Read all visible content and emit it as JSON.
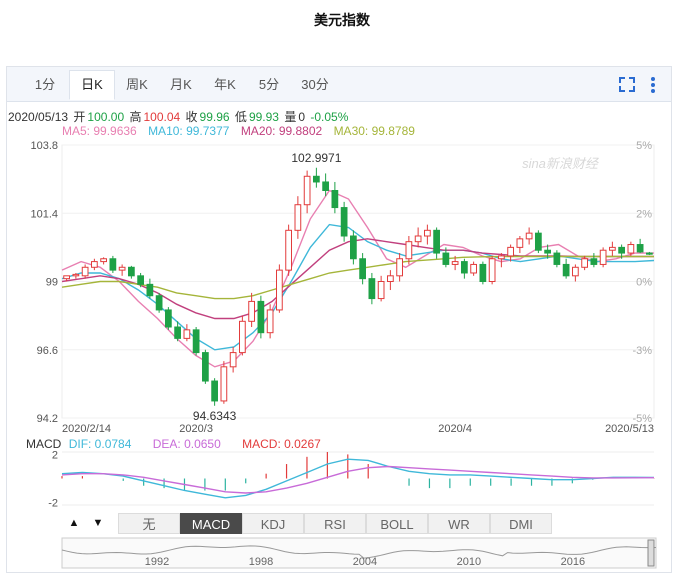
{
  "page_title": "美元指数",
  "tabs": [
    "1分",
    "日K",
    "周K",
    "月K",
    "年K",
    "5分",
    "30分"
  ],
  "active_tab": "日K",
  "toolbar": {
    "fullscreen_icon": "fullscreen-icon",
    "more_icon": "more-vertical-icon"
  },
  "quote": {
    "date": "2020/05/13",
    "open_label": "开",
    "open": "100.00",
    "high_label": "高",
    "high": "100.04",
    "close_label": "收",
    "close": "99.96",
    "low_label": "低",
    "low": "99.93",
    "volume_label": "量",
    "volume": "0",
    "change": "-0.05%"
  },
  "ma_legend": [
    {
      "label": "MA5: 99.9636",
      "color": "#e87fb1"
    },
    {
      "label": "MA10: 99.7377",
      "color": "#3fb8d9"
    },
    {
      "label": "MA20: 99.8802",
      "color": "#c1407e"
    },
    {
      "label": "MA30: 99.8789",
      "color": "#a5b53a"
    }
  ],
  "watermark": "sina新浪财经",
  "macd_legend": {
    "title": "MACD",
    "dif": "DIF: 0.0784",
    "dea": "DEA: 0.0650",
    "macd": "MACD: 0.0267"
  },
  "indicator_buttons": [
    "无",
    "MACD",
    "KDJ",
    "RSI",
    "BOLL",
    "WR",
    "DMI"
  ],
  "active_indicator": "MACD",
  "colors": {
    "up": "#e23b3b",
    "down": "#1ea146",
    "dif": "#3fb8d9",
    "dea": "#c86bd8"
  },
  "chart_data": {
    "type": "candlestick",
    "y_ticks": [
      "103.8",
      "101.4",
      "99",
      "96.6",
      "94.2"
    ],
    "ylim": [
      94.2,
      103.8
    ],
    "pct_ticks": [
      "5%",
      "2%",
      "0%",
      "-3%",
      "-5%"
    ],
    "x_tick_labels": [
      "2020/2/14",
      "2020/3",
      "2020/4",
      "2020/5/13"
    ],
    "annotations": {
      "max": "102.9971",
      "min": "94.6343"
    },
    "candles": [
      [
        99.1,
        99.2,
        99.0,
        99.2
      ],
      [
        99.2,
        99.3,
        99.1,
        99.25
      ],
      [
        99.2,
        99.6,
        99.1,
        99.5
      ],
      [
        99.5,
        99.8,
        99.4,
        99.7
      ],
      [
        99.7,
        99.85,
        99.6,
        99.8
      ],
      [
        99.8,
        99.9,
        99.3,
        99.4
      ],
      [
        99.4,
        99.6,
        99.2,
        99.5
      ],
      [
        99.5,
        99.55,
        99.1,
        99.2
      ],
      [
        99.2,
        99.3,
        98.8,
        98.9
      ],
      [
        98.9,
        99.1,
        98.4,
        98.5
      ],
      [
        98.5,
        98.6,
        97.9,
        98.0
      ],
      [
        98.0,
        98.1,
        97.3,
        97.4
      ],
      [
        97.4,
        97.6,
        96.9,
        97.0
      ],
      [
        97.0,
        97.5,
        96.9,
        97.3
      ],
      [
        97.3,
        97.4,
        96.4,
        96.5
      ],
      [
        96.5,
        96.6,
        95.4,
        95.5
      ],
      [
        95.5,
        95.6,
        94.63,
        94.8
      ],
      [
        94.8,
        96.2,
        94.7,
        96.0
      ],
      [
        96.0,
        96.7,
        95.8,
        96.5
      ],
      [
        96.5,
        97.8,
        96.4,
        97.6
      ],
      [
        97.6,
        98.6,
        97.4,
        98.3
      ],
      [
        98.3,
        98.5,
        97.0,
        97.2
      ],
      [
        97.2,
        98.2,
        97.0,
        98.0
      ],
      [
        98.0,
        99.6,
        97.9,
        99.4
      ],
      [
        99.4,
        101.0,
        99.2,
        100.8
      ],
      [
        100.8,
        102.0,
        100.5,
        101.7
      ],
      [
        101.7,
        102.9,
        101.4,
        102.7
      ],
      [
        102.7,
        103.0,
        102.3,
        102.5
      ],
      [
        102.5,
        102.8,
        102.0,
        102.2
      ],
      [
        102.2,
        102.5,
        101.4,
        101.6
      ],
      [
        101.6,
        101.8,
        100.4,
        100.6
      ],
      [
        100.6,
        100.8,
        99.6,
        99.8
      ],
      [
        99.8,
        100.0,
        98.9,
        99.1
      ],
      [
        99.1,
        99.3,
        98.2,
        98.4
      ],
      [
        98.4,
        99.2,
        98.3,
        99.0
      ],
      [
        99.0,
        99.4,
        98.7,
        99.2
      ],
      [
        99.2,
        100.0,
        99.0,
        99.8
      ],
      [
        99.8,
        100.6,
        99.6,
        100.4
      ],
      [
        100.4,
        100.9,
        100.2,
        100.6
      ],
      [
        100.6,
        101.0,
        100.3,
        100.8
      ],
      [
        100.8,
        100.9,
        99.8,
        100.0
      ],
      [
        100.0,
        100.2,
        99.5,
        99.6
      ],
      [
        99.6,
        99.9,
        99.4,
        99.7
      ],
      [
        99.7,
        99.8,
        99.1,
        99.3
      ],
      [
        99.3,
        99.7,
        99.2,
        99.6
      ],
      [
        99.6,
        99.7,
        98.9,
        99.0
      ],
      [
        99.0,
        99.9,
        98.9,
        99.8
      ],
      [
        99.8,
        100.0,
        99.5,
        99.9
      ],
      [
        99.9,
        100.3,
        99.7,
        100.2
      ],
      [
        100.2,
        100.6,
        100.0,
        100.5
      ],
      [
        100.5,
        100.9,
        100.3,
        100.7
      ],
      [
        100.7,
        100.8,
        100.0,
        100.1
      ],
      [
        100.1,
        100.3,
        99.8,
        100.0
      ],
      [
        100.0,
        100.1,
        99.5,
        99.6
      ],
      [
        99.6,
        99.8,
        99.1,
        99.2
      ],
      [
        99.2,
        99.6,
        99.0,
        99.5
      ],
      [
        99.5,
        99.9,
        99.4,
        99.8
      ],
      [
        99.8,
        100.0,
        99.5,
        99.6
      ],
      [
        99.6,
        100.2,
        99.5,
        100.1
      ],
      [
        100.1,
        100.4,
        99.9,
        100.2
      ],
      [
        100.2,
        100.3,
        99.8,
        100.0
      ],
      [
        100.0,
        100.4,
        99.9,
        100.3
      ],
      [
        100.3,
        100.5,
        100.0,
        100.04
      ],
      [
        100.0,
        100.04,
        99.93,
        99.96
      ]
    ],
    "ma": {
      "MA5": [
        99.4,
        99.7,
        99.5,
        99.0,
        98.3,
        97.7,
        97.0,
        96.4,
        96.0,
        96.2,
        96.9,
        98.0,
        99.5,
        101.2,
        102.2,
        101.9,
        100.9,
        99.8,
        99.5,
        99.9,
        100.3,
        100.2,
        99.9,
        99.7,
        99.8,
        100.2,
        100.3,
        99.9,
        99.7,
        99.8,
        100.0,
        100.0
      ],
      "MA10": [
        99.1,
        99.3,
        99.3,
        99.1,
        98.7,
        98.2,
        97.6,
        97.0,
        96.6,
        96.7,
        97.2,
        97.9,
        99.0,
        100.2,
        101.0,
        100.9,
        100.4,
        100.1,
        99.9,
        100.0,
        100.1,
        100.1,
        100.0,
        99.8,
        99.7,
        99.8,
        99.9,
        99.8,
        99.7,
        99.7,
        99.7,
        99.74
      ],
      "MA20": [
        99.0,
        99.1,
        99.2,
        99.1,
        98.9,
        98.6,
        98.2,
        97.9,
        97.7,
        97.7,
        97.9,
        98.3,
        98.9,
        99.5,
        100.1,
        100.4,
        100.5,
        100.4,
        100.3,
        100.2,
        100.1,
        100.1,
        100.0,
        99.95,
        99.9,
        99.9,
        99.9,
        99.88,
        99.88,
        99.88,
        99.88,
        99.88
      ],
      "MA30": [
        98.8,
        98.9,
        99.0,
        99.0,
        98.9,
        98.8,
        98.6,
        98.5,
        98.4,
        98.4,
        98.5,
        98.7,
        98.9,
        99.1,
        99.3,
        99.4,
        99.5,
        99.6,
        99.7,
        99.75,
        99.8,
        99.85,
        99.87,
        99.88,
        99.88,
        99.88,
        99.88,
        99.88,
        99.88,
        99.88,
        99.88,
        99.88
      ]
    },
    "macd": {
      "y_ticks": [
        "2",
        "-2"
      ],
      "ylim": [
        -2.2,
        2.2
      ],
      "dif": [
        0.4,
        0.5,
        0.4,
        0.2,
        -0.2,
        -0.6,
        -1.0,
        -1.3,
        -1.6,
        -1.4,
        -0.9,
        -0.2,
        0.5,
        1.2,
        1.6,
        1.5,
        1.0,
        0.6,
        0.4,
        0.3,
        0.3,
        0.2,
        0.1,
        0.0,
        -0.1,
        -0.1,
        0.0,
        0.1,
        0.1,
        0.08
      ],
      "dea": [
        0.3,
        0.4,
        0.4,
        0.3,
        0.1,
        -0.2,
        -0.5,
        -0.8,
        -1.1,
        -1.2,
        -1.1,
        -0.8,
        -0.4,
        0.1,
        0.6,
        0.9,
        1.0,
        0.9,
        0.8,
        0.7,
        0.6,
        0.5,
        0.4,
        0.3,
        0.2,
        0.1,
        0.05,
        0.05,
        0.06,
        0.065
      ]
    },
    "overview_ticks": [
      "1992",
      "1998",
      "2004",
      "2010",
      "2016"
    ]
  }
}
